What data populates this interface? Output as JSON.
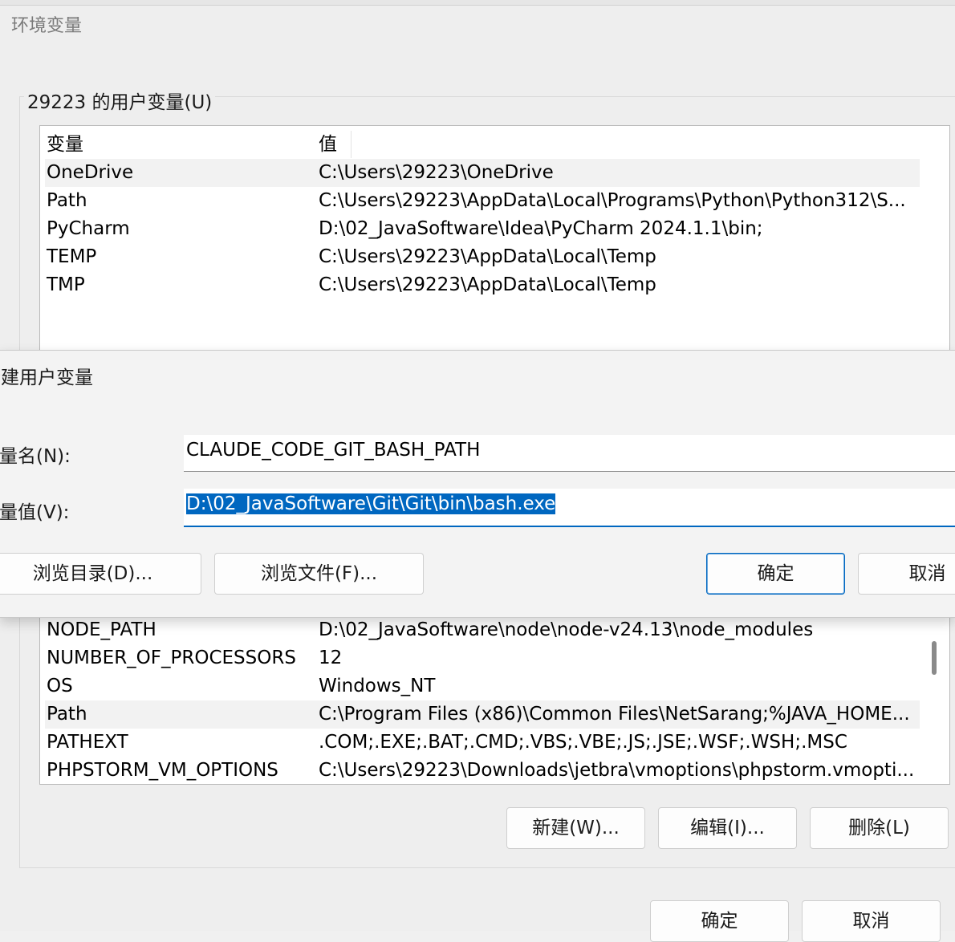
{
  "background_window": {
    "title": "环境变量",
    "user_group_label": "29223 的用户变量(U)",
    "user_columns": [
      "变量",
      "值"
    ],
    "user_vars": [
      {
        "name": "OneDrive",
        "value": "C:\\Users\\29223\\OneDrive"
      },
      {
        "name": "Path",
        "value": "C:\\Users\\29223\\AppData\\Local\\Programs\\Python\\Python312\\S..."
      },
      {
        "name": "PyCharm",
        "value": "D:\\02_JavaSoftware\\Idea\\PyCharm 2024.1.1\\bin;"
      },
      {
        "name": "TEMP",
        "value": "C:\\Users\\29223\\AppData\\Local\\Temp"
      },
      {
        "name": "TMP",
        "value": "C:\\Users\\29223\\AppData\\Local\\Temp"
      }
    ],
    "system_vars": [
      {
        "name": "NODE_PATH",
        "value": "D:\\02_JavaSoftware\\node\\node-v24.13\\node_modules"
      },
      {
        "name": "NUMBER_OF_PROCESSORS",
        "value": "12"
      },
      {
        "name": "OS",
        "value": "Windows_NT"
      },
      {
        "name": "Path",
        "value": "C:\\Program Files (x86)\\Common Files\\NetSarang;%JAVA_HOME..."
      },
      {
        "name": "PATHEXT",
        "value": ".COM;.EXE;.BAT;.CMD;.VBS;.VBE;.JS;.JSE;.WSF;.WSH;.MSC"
      },
      {
        "name": "PHPSTORM_VM_OPTIONS",
        "value": "C:\\Users\\29223\\Downloads\\jetbra\\vmoptions\\phpstorm.vmopti..."
      }
    ],
    "system_buttons": {
      "new": "新建(W)...",
      "edit": "编辑(I)...",
      "delete": "删除(L)"
    },
    "bottom_buttons": {
      "ok": "确定",
      "cancel": "取消"
    }
  },
  "new_user_var_dialog": {
    "title": "新建用户变量",
    "name_label": "变量名(N):",
    "name_value": "CLAUDE_CODE_GIT_BASH_PATH",
    "value_label": "变量值(V):",
    "value_value": "D:\\02_JavaSoftware\\Git\\Git\\bin\\bash.exe",
    "browse_dir": "浏览目录(D)...",
    "browse_file": "浏览文件(F)...",
    "ok": "确定",
    "cancel": "取消"
  },
  "colors": {
    "accent": "#0067c0",
    "row_selected": "#f2f2f2"
  }
}
